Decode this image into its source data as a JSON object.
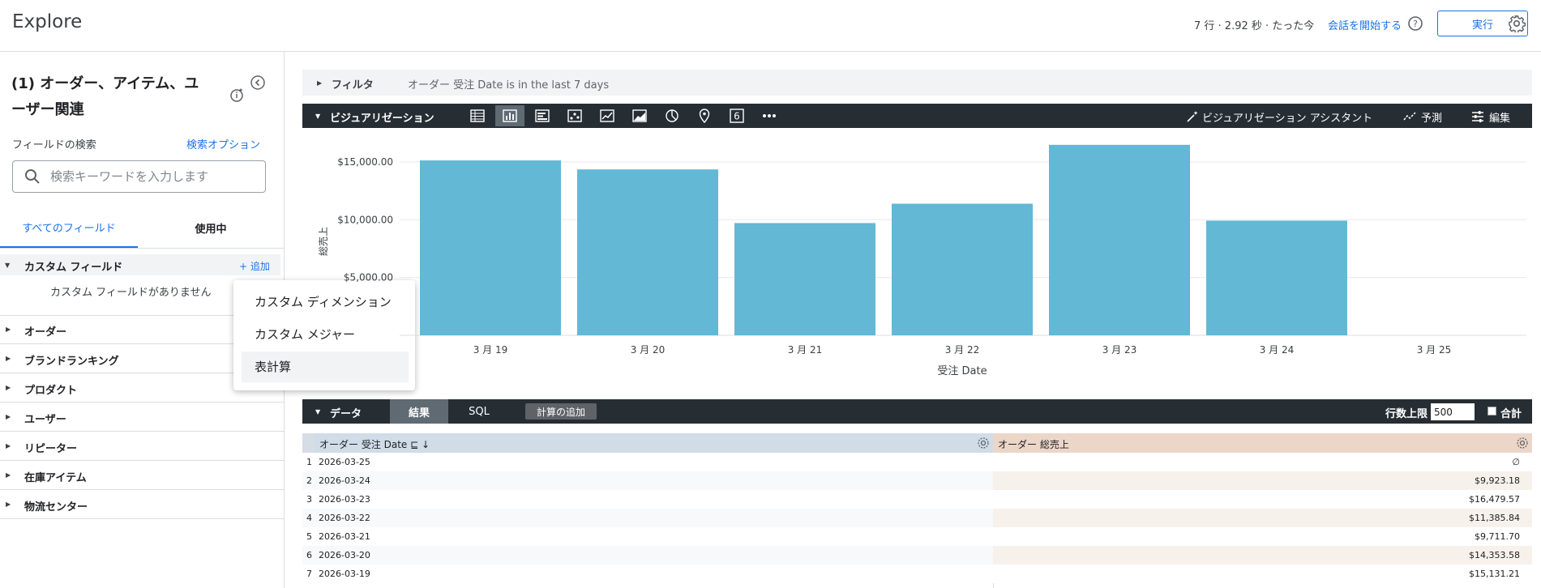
{
  "app": {
    "title": "Explore"
  },
  "topbar": {
    "meta": "7 行 · 2.92 秒 · たった今",
    "chat": "会話を開始する",
    "run_label": "実行"
  },
  "sidebar": {
    "model_title": "(1) オーダー、アイテム、ユーザー関連",
    "field_search_label": "フィールドの検索",
    "search_options": "検索オプション",
    "search_placeholder": "検索キーワードを入力します",
    "tabs": [
      {
        "label": "すべてのフィールド"
      },
      {
        "label": "使用中"
      }
    ],
    "custom": {
      "label": "カスタム フィールド",
      "add": "+ 追加",
      "empty": "カスタム フィールドがありません"
    },
    "categories": [
      {
        "label": "オーダー"
      },
      {
        "label": "ブランドランキング"
      },
      {
        "label": "プロダクト"
      },
      {
        "label": "ユーザー"
      },
      {
        "label": "リピーター"
      },
      {
        "label": "在庫アイテム"
      },
      {
        "label": "物流センター"
      }
    ]
  },
  "popup": {
    "items": [
      {
        "label": "カスタム ディメンション"
      },
      {
        "label": "カスタム メジャー"
      },
      {
        "label": "表計算"
      }
    ]
  },
  "filter": {
    "label": "フィルタ",
    "text": "オーダー 受注 Date is in the last 7 days"
  },
  "visualization": {
    "label": "ビジュアリゼーション",
    "icons": [
      "table-icon",
      "column-chart-icon",
      "bar-chart-icon",
      "scatter-icon",
      "line-chart-icon",
      "area-chart-icon",
      "pie-chart-icon",
      "map-pin-icon",
      "single-value-icon",
      "more-icon"
    ],
    "single_value_glyph": "6",
    "assistant": "ビジュアリゼーション アシスタント",
    "forecast": "予測",
    "edit": "編集"
  },
  "chart_data": {
    "type": "bar",
    "categories": [
      "3 月 19",
      "3 月 20",
      "3 月 21",
      "3 月 22",
      "3 月 23",
      "3 月 24",
      "3 月 25"
    ],
    "values": [
      15131.21,
      14353.58,
      9711.7,
      11385.84,
      16479.57,
      9923.18,
      null
    ],
    "ylabel": "総売上",
    "xlabel": "受注 Date",
    "yticks": [
      "$5,000.00",
      "$10,000.00",
      "$15,000.00"
    ],
    "ytick_values": [
      5000,
      10000,
      15000
    ],
    "color": "#62b8d5",
    "grid": true
  },
  "data_section": {
    "label": "データ",
    "tabs": {
      "results": "結果",
      "sql": "SQL"
    },
    "add_calc": "計算の追加",
    "row_limit_label": "行数上限",
    "row_limit": "500",
    "total_label": "合計"
  },
  "table": {
    "columns": [
      "オーダー 受注 Date",
      "オーダー 総売上"
    ],
    "rows": [
      {
        "num": "1",
        "date": "2026-03-25",
        "sales": "∅"
      },
      {
        "num": "2",
        "date": "2026-03-24",
        "sales": "$9,923.18"
      },
      {
        "num": "3",
        "date": "2026-03-23",
        "sales": "$16,479.57"
      },
      {
        "num": "4",
        "date": "2026-03-22",
        "sales": "$11,385.84"
      },
      {
        "num": "5",
        "date": "2026-03-21",
        "sales": "$9,711.70"
      },
      {
        "num": "6",
        "date": "2026-03-20",
        "sales": "$14,353.58"
      },
      {
        "num": "7",
        "date": "2026-03-19",
        "sales": "$15,131.21"
      }
    ]
  }
}
